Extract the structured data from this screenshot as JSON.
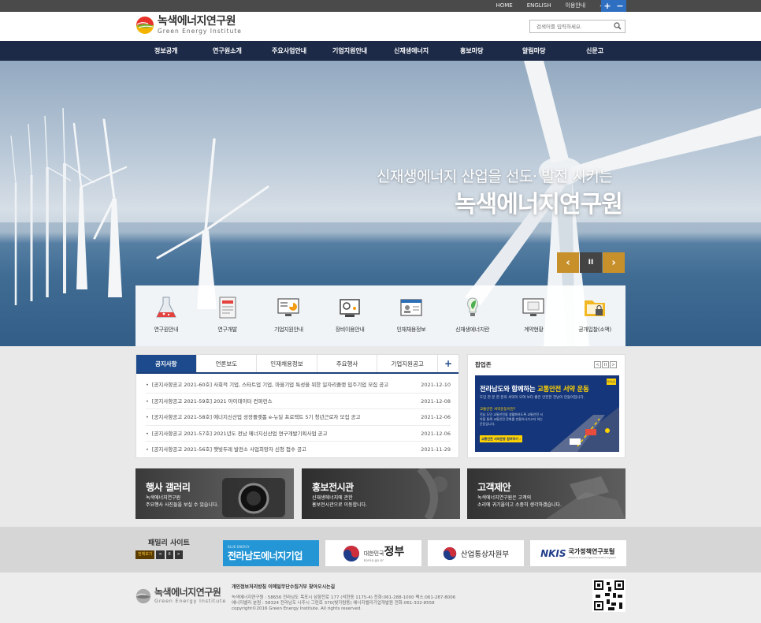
{
  "util": {
    "links": [
      "HOME",
      "ENGLISH",
      "이용안내",
      "사이트맵"
    ],
    "zoom_in": "+",
    "zoom_out": "−"
  },
  "header": {
    "logo_ko": "녹색에너지연구원",
    "logo_en": "Green Energy Institute",
    "search_placeholder": "검색어를 입력하세요."
  },
  "gnb": [
    "정보공개",
    "연구원소개",
    "주요사업안내",
    "기업지원안내",
    "신재생에너지",
    "홍보마당",
    "알림마당",
    "신문고"
  ],
  "hero": {
    "subtitle": "신재생에너지 산업을 선도· 발전 시키는",
    "title": "녹색에너지연구원",
    "prev": "‹",
    "pause": "II",
    "next": "›"
  },
  "quick_menu": [
    {
      "label": "연구원안내",
      "icon": "flask-icon"
    },
    {
      "label": "연구개발",
      "icon": "document-icon"
    },
    {
      "label": "기업지원안내",
      "icon": "monitor-chart-icon"
    },
    {
      "label": "장비이용안내",
      "icon": "equipment-icon"
    },
    {
      "label": "인재채용정보",
      "icon": "id-card-icon"
    },
    {
      "label": "신재생에너지란",
      "icon": "leaf-bulb-icon"
    },
    {
      "label": "계약현황",
      "icon": "monitor-icon"
    },
    {
      "label": "공개입찰(소액)",
      "icon": "folder-lock-icon"
    }
  ],
  "notice": {
    "tabs": [
      "공지사항",
      "언론보도",
      "인재채용정보",
      "주요행사",
      "기업지원공고"
    ],
    "more": "+",
    "items": [
      {
        "title": "[공지사항공고 2021-60호] 사회적 기업, 스타트업 기업, 마을기업 특성을 위한 일자리플랫 입주기업 모집 공고",
        "date": "2021-12-10"
      },
      {
        "title": "[공지사항공고 2021-59호] 2021 아이데이터 컨퍼런스",
        "date": "2021-12-08"
      },
      {
        "title": "[공지사항공고 2021-58호] 에너지신산업 성장플랫폼 e-뉴딜 프로젝트 5기 청년근로자 모집 공고",
        "date": "2021-12-06"
      },
      {
        "title": "[공지사항공고 2021-57호] 2021년도 전남 에너지신산업 연구개발기획사업 공고",
        "date": "2021-12-06"
      },
      {
        "title": "[공지사항공고 2021-56호] 햇빛두레 발전소 사업희망자 신청 접수 공고",
        "date": "2021-11-29"
      }
    ]
  },
  "popup": {
    "title": "팝업존",
    "ctrl": [
      "<",
      "II",
      ">"
    ],
    "banner_title_a": "전라남도와 함께하는 ",
    "banner_title_b": "교통안전 서약 운동",
    "banner_sub": "도민 한 분 한 분의 서약이 모여 보다 좋은 안전한 전남이 만들어집니다.",
    "banner_q": "교통안전 서약운동이란?",
    "banner_body": "전남 도민 교통안전을 생활화하도록 교통안전 서약을 통해 교통안전 문화를 만들어나가고자 하는 운동입니다.",
    "banner_btn": "교통안전 서약운동 참여하기 ›",
    "banner_badge": "전라남도"
  },
  "promos": [
    {
      "title": "행사 갤러리",
      "desc1": "녹색에너지연구원",
      "desc2": "주요행사 사진들을 보실 수 있습니다."
    },
    {
      "title": "홍보전시관",
      "desc1": "신재생에너지에 관한",
      "desc2": "홍보전시관으로 이동합니다."
    },
    {
      "title": "고객제안",
      "desc1": "녹색에너지연구원은 고객의",
      "desc2": "소리에 귀기울이고 소중히 생각하겠습니다."
    }
  ],
  "family": {
    "title": "패밀리 사이트",
    "btns": [
      "전체보기",
      "<",
      "II",
      ">"
    ],
    "logos": {
      "jeonnam_small": "BLUE ENERGY",
      "jeonnam": "전라남도에너지기업",
      "gov_small": "대한민국",
      "gov": "정부",
      "gov_url": "korea.go.kr",
      "motie": "산업통상자원부",
      "nkis": "NKIS",
      "nkis_name": "국가정책연구포털",
      "nkis_sub": "National Knowledge Information System"
    }
  },
  "footer": {
    "logo_ko": "녹색에너지연구원",
    "logo_en": "Green Energy Institute",
    "links": "개인정보처리방침   이메일무단수집거부   찾아오시는길",
    "addr1": "녹색에너지연구원 : 58656 전라남도 목포시 삼향천로 177 (석현동 1175-4) 전화:061-288-1000 팩스:061-287-8006",
    "addr2": "에너지밸리 분원 : 58324 전라남도 나주시 그린로 370(빛가람동) 에너지밸리기업개발원 전화:061-332-8558",
    "copyright": "copyright©2016 Green Energy Institute. All rights reserved."
  },
  "colors": {
    "gnb": "#1c2a48",
    "accent": "#1c4a8c",
    "zoom": "#2f6fc2"
  }
}
